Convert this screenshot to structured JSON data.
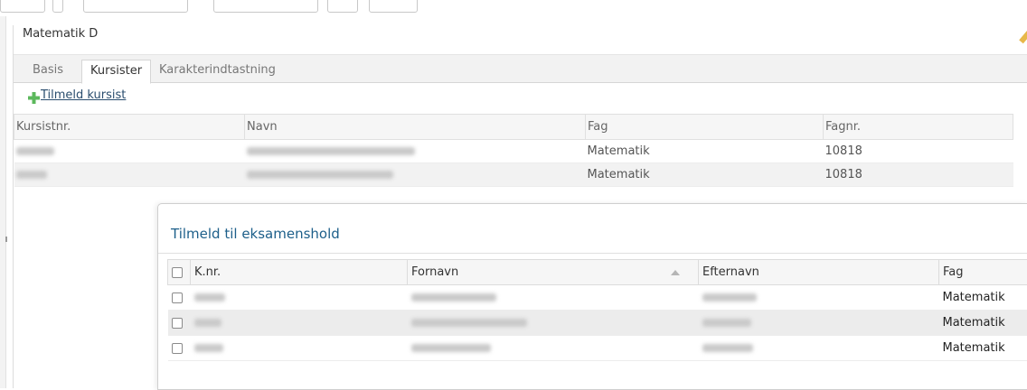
{
  "panel": {
    "title": "Matematik D"
  },
  "tabs": [
    {
      "label": "Basis"
    },
    {
      "label": "Kursister"
    },
    {
      "label": "Karakterindtastning"
    }
  ],
  "active_tab": "Kursister",
  "actions": {
    "add_student": "Tilmeld kursist"
  },
  "students_table": {
    "headers": [
      "Kursistnr.",
      "Navn",
      "Fag",
      "Fagnr."
    ],
    "rows": [
      {
        "fag": "Matematik",
        "fagnr": "10818"
      },
      {
        "fag": "Matematik",
        "fagnr": "10818"
      }
    ]
  },
  "modal": {
    "title": "Tilmeld til eksamenshold",
    "headers": [
      "K.nr.",
      "Fornavn",
      "Efternavn",
      "Fag"
    ],
    "sorted_column": "Fornavn",
    "rows": [
      {
        "fag": "Matematik"
      },
      {
        "fag": "Matematik"
      },
      {
        "fag": "Matematik"
      }
    ]
  },
  "colors": {
    "modal_title": "#1d5f8a",
    "link": "#2a4d6e",
    "add_icon": "#5cb85c"
  }
}
